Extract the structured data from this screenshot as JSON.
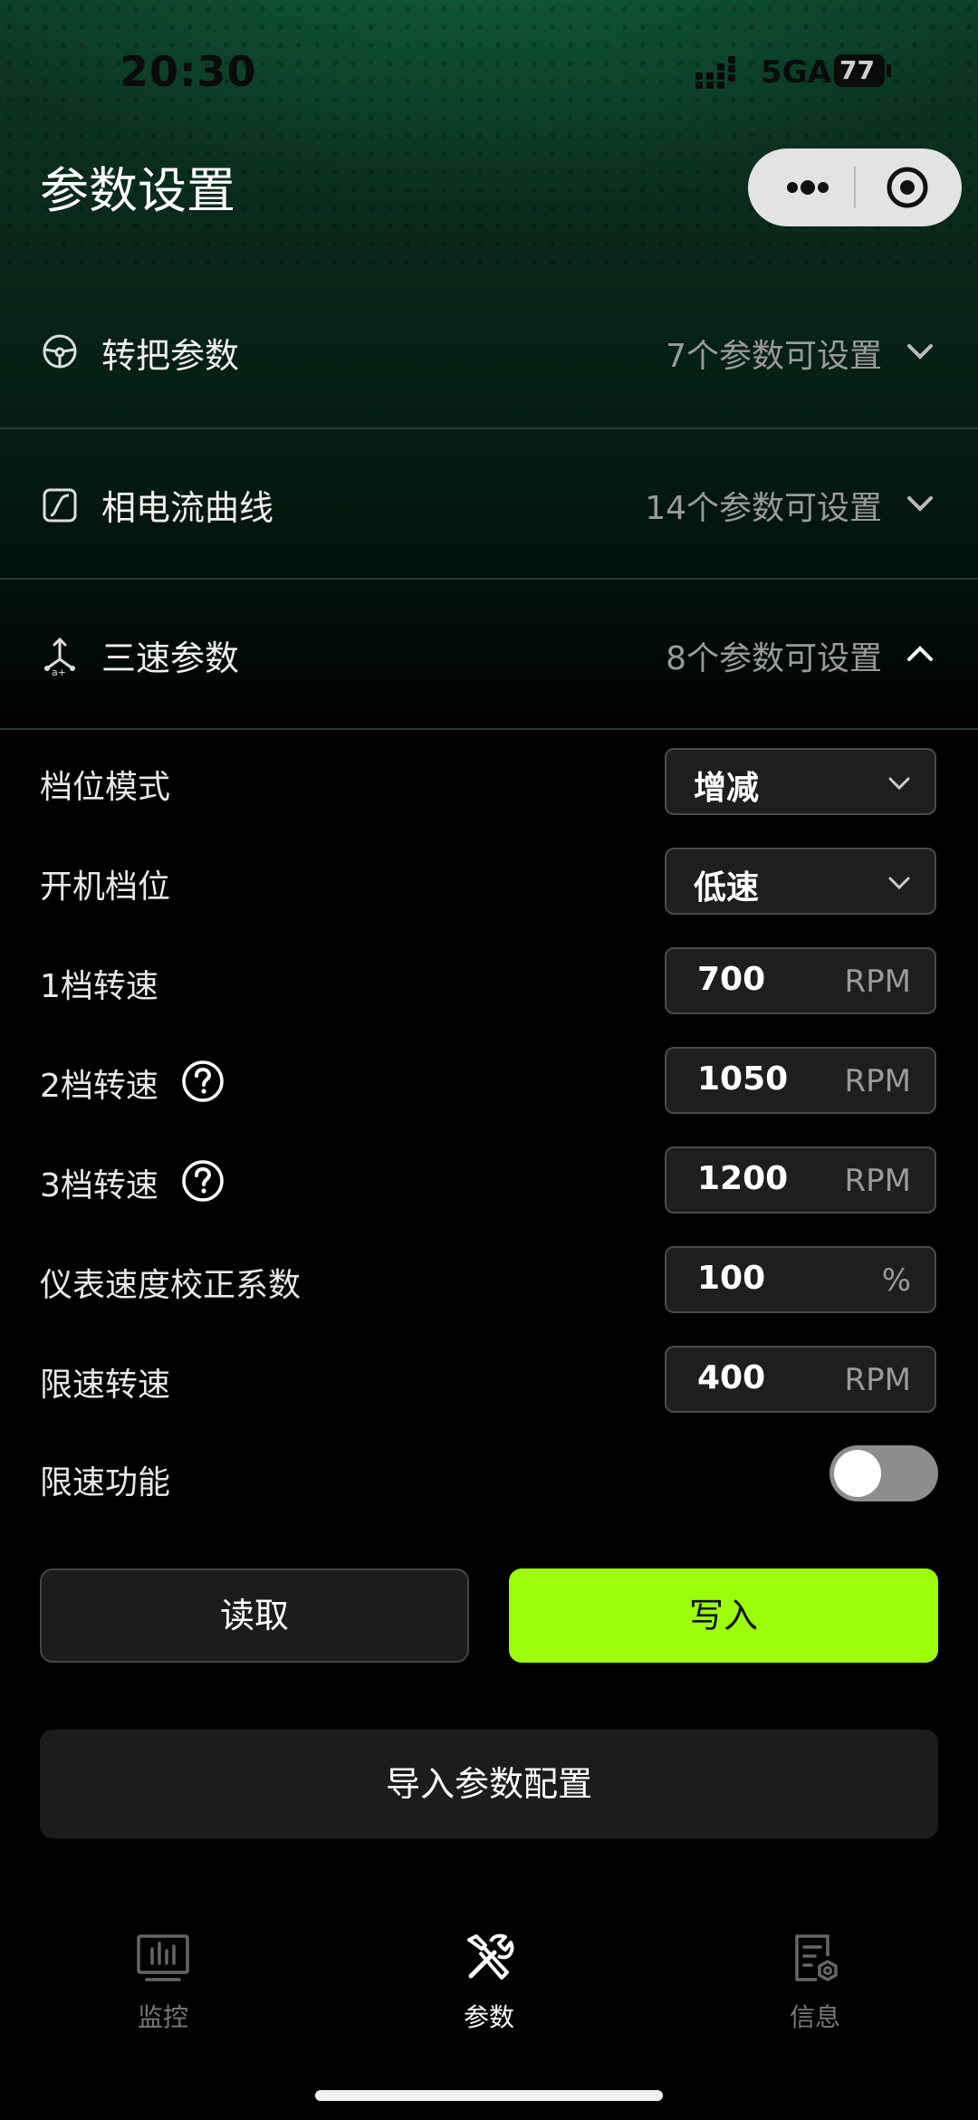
{
  "status_bar": {
    "time": "20:30",
    "network": "5GA",
    "battery": "77"
  },
  "header": {
    "title": "参数设置"
  },
  "sections": [
    {
      "title": "转把参数",
      "count_text": "7个参数可设置",
      "icon": "steering-wheel-icon",
      "expanded": false
    },
    {
      "title": "相电流曲线",
      "count_text": "14个参数可设置",
      "icon": "curve-icon",
      "expanded": false
    },
    {
      "title": "三速参数",
      "count_text": "8个参数可设置",
      "icon": "gear-shift-icon",
      "expanded": true
    }
  ],
  "params": [
    {
      "label": "档位模式",
      "value": "增减",
      "unit": "",
      "type": "select"
    },
    {
      "label": "开机档位",
      "value": "低速",
      "unit": "",
      "type": "select"
    },
    {
      "label": "1档转速",
      "value": "700",
      "unit": "RPM",
      "type": "input"
    },
    {
      "label": "2档转速",
      "value": "1050",
      "unit": "RPM",
      "type": "input",
      "help": true
    },
    {
      "label": "3档转速",
      "value": "1200",
      "unit": "RPM",
      "type": "input",
      "help": true
    },
    {
      "label": "仪表速度校正系数",
      "value": "100",
      "unit": "%",
      "type": "input"
    },
    {
      "label": "限速转速",
      "value": "400",
      "unit": "RPM",
      "type": "input"
    },
    {
      "label": "限速功能",
      "type": "toggle",
      "on": false
    }
  ],
  "actions": {
    "read_label": "读取",
    "write_label": "写入",
    "import_label": "导入参数配置"
  },
  "bottom_nav": [
    {
      "label": "监控",
      "icon": "monitor-chart-icon",
      "active": false
    },
    {
      "label": "参数",
      "icon": "tools-icon",
      "active": true
    },
    {
      "label": "信息",
      "icon": "info-document-icon",
      "active": false
    }
  ],
  "colors": {
    "accent": "#9cff09",
    "background": "#000000",
    "header_green": "#0c3a26",
    "muted_text": "#9a9a9a"
  }
}
